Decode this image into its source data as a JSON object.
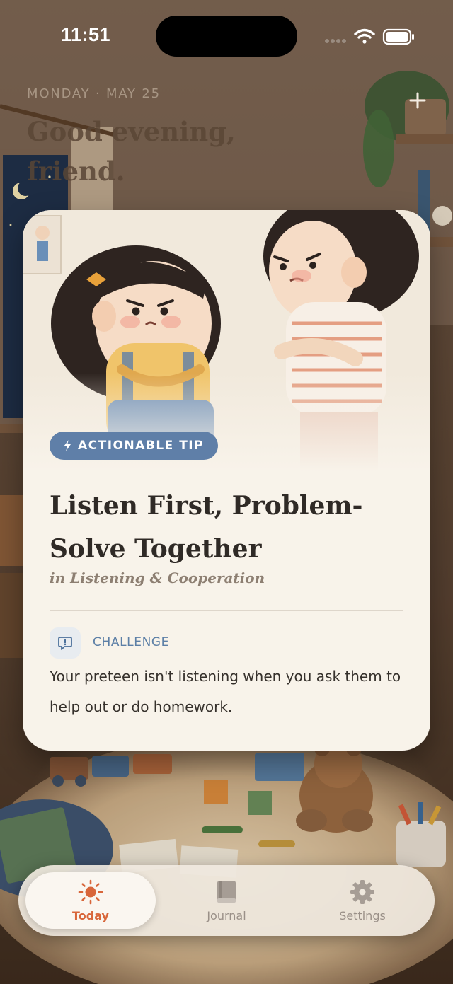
{
  "status_bar": {
    "time": "11:51"
  },
  "header": {
    "date": "MONDAY · MAY 25",
    "greeting": "Good evening, friend.",
    "add_icon": "plus-icon"
  },
  "card": {
    "badge": {
      "icon": "lightning-icon",
      "label": "ACTIONABLE TIP",
      "color": "#5f7fa8"
    },
    "title": "Listen First, Problem-Solve Together",
    "category": "in Listening & Cooperation",
    "challenge": {
      "icon": "speech-bubble-exclamation-icon",
      "label": "CHALLENGE",
      "text": "Your preteen isn't listening when you ask them to help out or do homework."
    }
  },
  "tab_bar": {
    "tabs": [
      {
        "label": "Today",
        "icon": "sun-icon",
        "active": true
      },
      {
        "label": "Journal",
        "icon": "book-icon",
        "active": false
      },
      {
        "label": "Settings",
        "icon": "gear-icon",
        "active": false
      }
    ],
    "accent": "#d8663a"
  }
}
